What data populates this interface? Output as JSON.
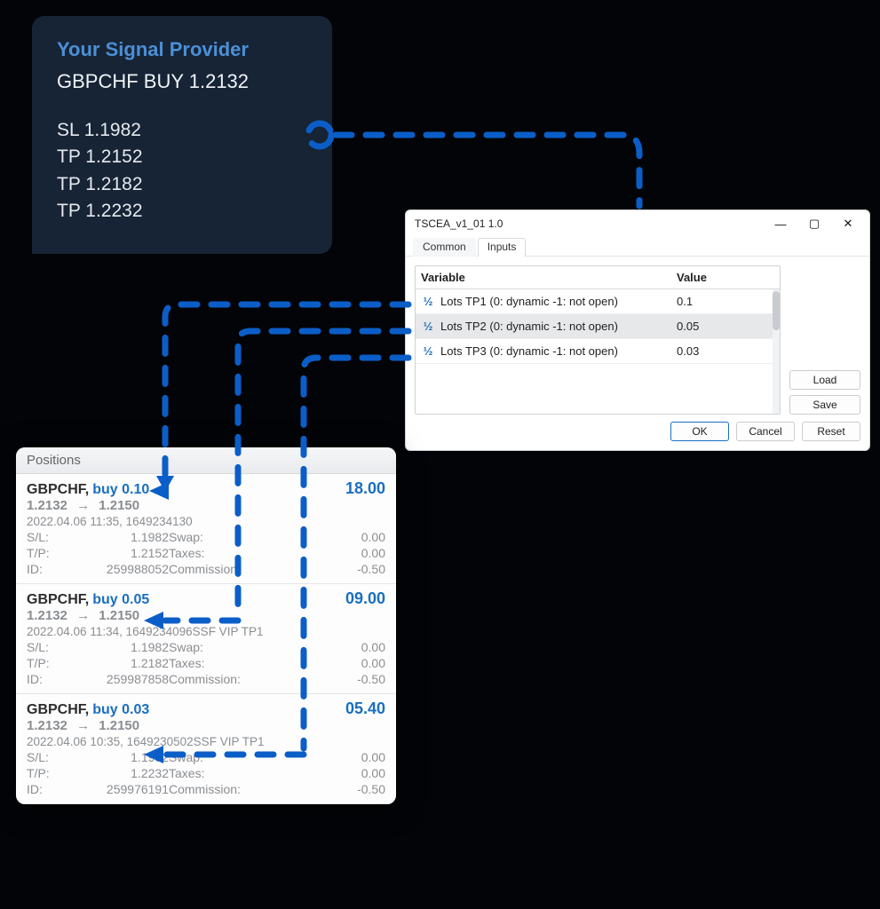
{
  "signal": {
    "provider": "Your Signal Provider",
    "headline": "GBPCHF BUY 1.2132",
    "sl": "SL 1.1982",
    "tp1": "TP 1.2152",
    "tp2": "TP 1.2182",
    "tp3": "TP 1.2232"
  },
  "dialog": {
    "title": "TSCEA_v1_01 1.0",
    "tabs": {
      "common": "Common",
      "inputs": "Inputs"
    },
    "header": {
      "var": "Variable",
      "val": "Value"
    },
    "rows": [
      {
        "var": "Lots TP1 (0: dynamic -1: not open)",
        "val": "0.1"
      },
      {
        "var": "Lots TP2 (0: dynamic -1: not open)",
        "val": "0.05"
      },
      {
        "var": "Lots TP3 (0: dynamic -1: not open)",
        "val": "0.03"
      }
    ],
    "buttons": {
      "load": "Load",
      "save": "Save",
      "ok": "OK",
      "cancel": "Cancel",
      "reset": "Reset"
    }
  },
  "positions": {
    "title": "Positions",
    "labels": {
      "sl": "S/L:",
      "tp": "T/P:",
      "id": "ID:",
      "swap": "Swap:",
      "taxes": "Taxes:",
      "comm": "Commission:"
    },
    "items": [
      {
        "symbol": "GBPCHF,",
        "side": "buy 0.10",
        "pl": "18.00",
        "open": "1.2132",
        "current": "1.2150",
        "meta": "2022.04.06 11:35, 1649234130",
        "sl": "1.1982",
        "tp": "1.2152",
        "id": "259988052",
        "swap": "0.00",
        "taxes": "0.00",
        "comm": "-0.50"
      },
      {
        "symbol": "GBPCHF,",
        "side": "buy 0.05",
        "pl": "09.00",
        "open": "1.2132",
        "current": "1.2150",
        "meta": "2022.04.06 11:34, 1649234096SSF VIP TP1",
        "sl": "1.1982",
        "tp": "1.2182",
        "id": "259987858",
        "swap": "0.00",
        "taxes": "0.00",
        "comm": "-0.50"
      },
      {
        "symbol": "GBPCHF,",
        "side": "buy 0.03",
        "pl": "05.40",
        "open": "1.2132",
        "current": "1.2150",
        "meta": "2022.04.06 10:35, 1649230502SSF VIP TP1",
        "sl": "1.1982",
        "tp": "1.2232",
        "id": "259976191",
        "swap": "0.00",
        "taxes": "0.00",
        "comm": "-0.50"
      }
    ]
  }
}
